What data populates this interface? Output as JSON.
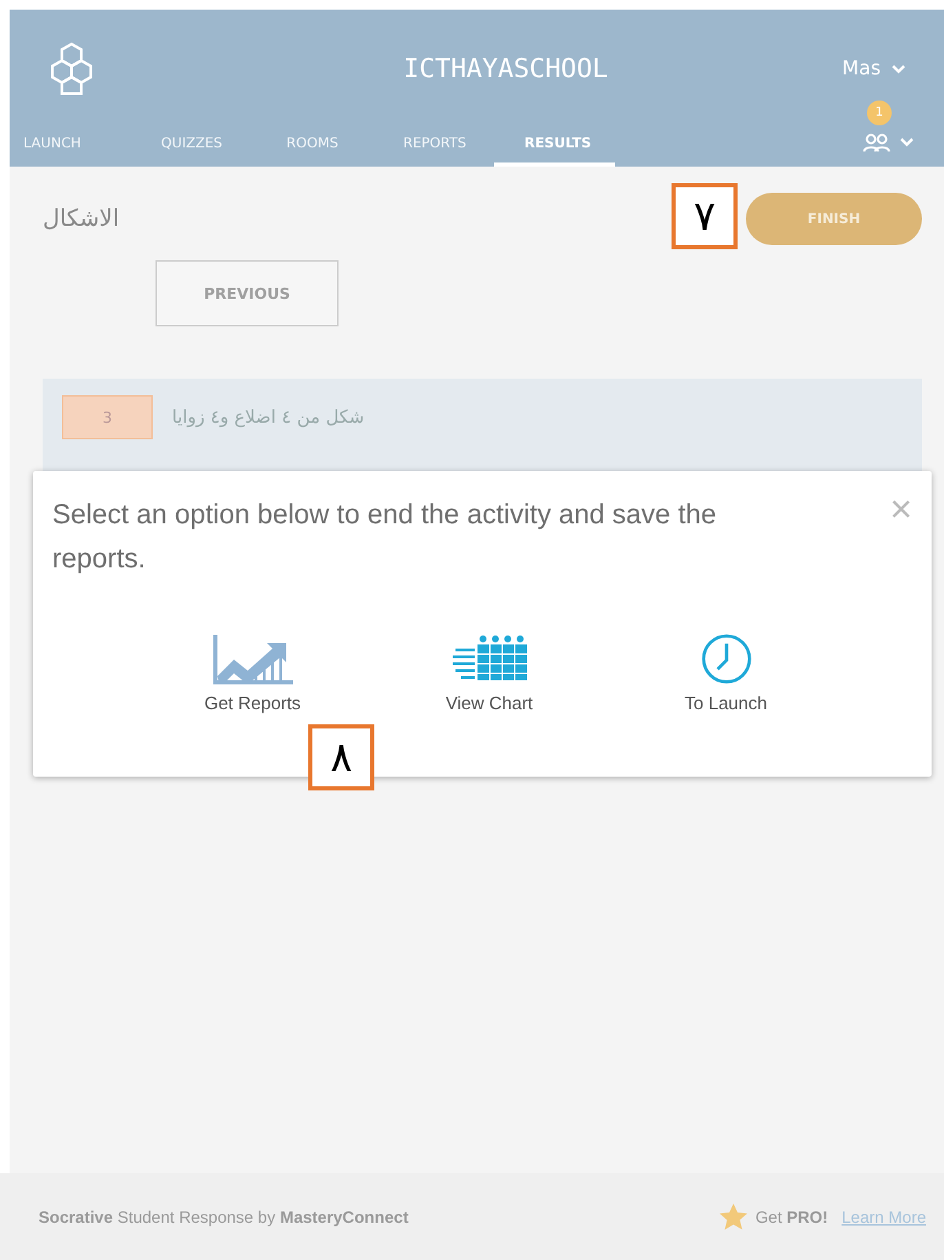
{
  "header": {
    "school": "ICTHAYASCHOOL",
    "user": "Mas",
    "notification_count": "1"
  },
  "tabs": [
    {
      "label": "LAUNCH",
      "selected": false
    },
    {
      "label": "QUIZZES",
      "selected": false
    },
    {
      "label": "ROOMS",
      "selected": false
    },
    {
      "label": "REPORTS",
      "selected": false
    },
    {
      "label": "RESULTS",
      "selected": true
    }
  ],
  "activity": {
    "title": "الاشكال",
    "finish_button": "FINISH",
    "previous_button": "PREVIOUS"
  },
  "question": {
    "number": "3",
    "text": "شكل من ٤ اضلاع و٤ زوايا"
  },
  "callouts": [
    {
      "label": "٧"
    },
    {
      "label": "٨"
    }
  ],
  "modal": {
    "message": "Select an option below to end the activity and save the reports.",
    "close": "×",
    "options": [
      {
        "kind": "reports",
        "label": "Get Reports"
      },
      {
        "kind": "chart",
        "label": "View Chart"
      },
      {
        "kind": "launch",
        "label": "To Launch"
      }
    ]
  },
  "footer": {
    "credit": "**Socrative** Student Response by **MasteryConnect**",
    "pro": "Get **PRO!**",
    "learn_more": "Learn More"
  }
}
